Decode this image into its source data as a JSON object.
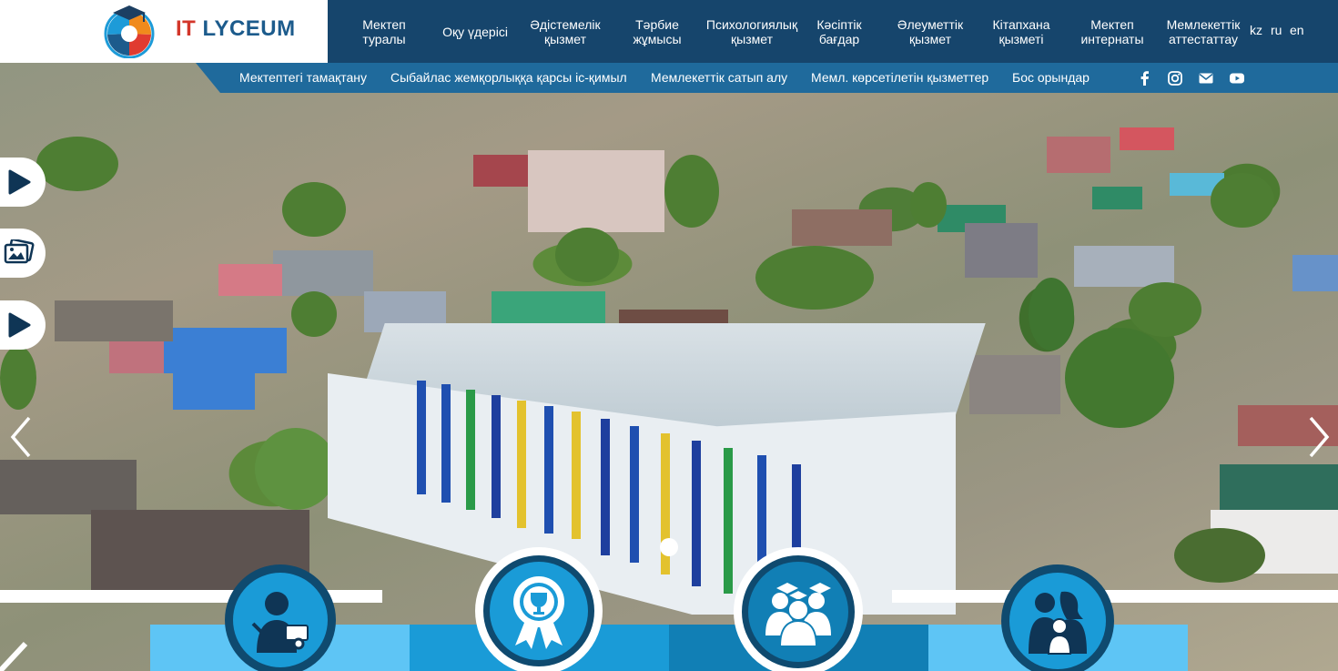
{
  "logo": {
    "part1": "IT",
    "part2": "LYCEUM"
  },
  "topnav": [
    {
      "line1": "Мектеп",
      "line2": "туралы"
    },
    {
      "line1": "Оқу үдерісі",
      "line2": ""
    },
    {
      "line1": "Әдістемелік",
      "line2": "қызмет"
    },
    {
      "line1": "Тәрбие",
      "line2": "жұмысы"
    },
    {
      "line1": "Психологиялық",
      "line2": "қызмет"
    },
    {
      "line1": "Кәсіптік",
      "line2": "бағдар"
    },
    {
      "line1": "Әлеуметтік",
      "line2": "қызмет"
    },
    {
      "line1": "Кітапхана",
      "line2": "қызметі"
    },
    {
      "line1": "Мектеп",
      "line2": "интернаты"
    },
    {
      "line1": "Мемлекеттік",
      "line2": "аттестаттау"
    }
  ],
  "languages": [
    "kz",
    "ru",
    "en"
  ],
  "subnav": [
    "Мектептегі тамақтану",
    "Сыбайлас жемқорлыққа қарсы іс-қимыл",
    "Мемлекеттік сатып алу",
    "Мемл. көрсетілетін қызметтер",
    "Бос орындар"
  ],
  "social_icons": [
    "facebook-icon",
    "instagram-icon",
    "envelope-icon",
    "youtube-icon"
  ],
  "side_buttons": [
    "play-icon",
    "photo-gallery-icon",
    "play-icon"
  ],
  "feature_icons": [
    "teacher-icon",
    "award-icon",
    "graduates-icon",
    "family-icon"
  ],
  "colors": {
    "nav_dark": "#16456c",
    "nav_sub": "#1f6a9c",
    "panel_light": "#5ec5f5",
    "panel_mid": "#1a9bd7",
    "panel_dark": "#117fb5",
    "circle": "#0f4a6f",
    "logo_red": "#d3362a",
    "logo_blue": "#1c5b8c"
  }
}
